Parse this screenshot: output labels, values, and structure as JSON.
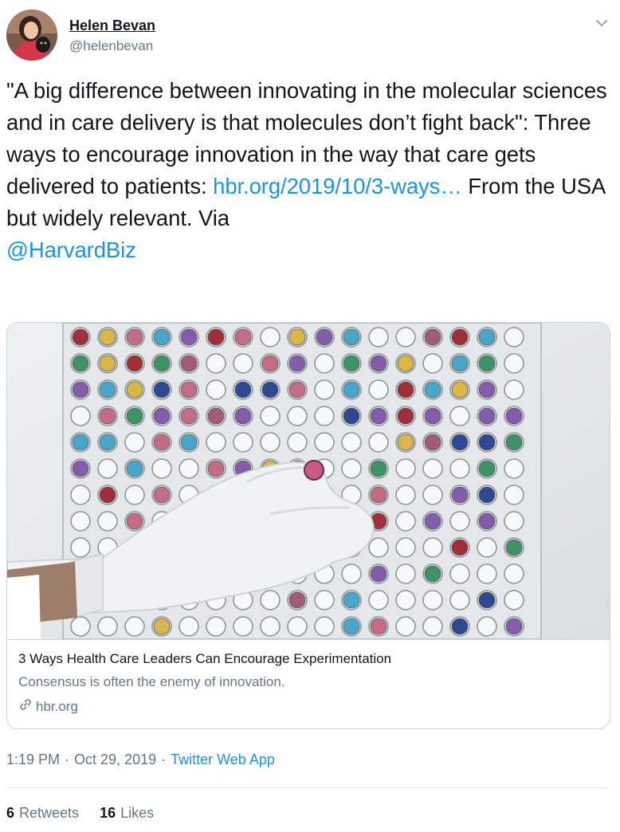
{
  "author": {
    "name": "Helen Bevan",
    "handle": "@helenbevan"
  },
  "tweet": {
    "text_1": "\"A big difference between innovating in the molecular sciences and in care delivery is that molecules don’t fight back\": Three ways to encourage innovation in the way that care gets delivered to patients: ",
    "link": "hbr.org/2019/10/3-ways…",
    "text_2": " From the USA but widely relevant. Via",
    "mention": "@HarvardBiz"
  },
  "card": {
    "title": "3 Ways Health Care Leaders Can Encourage Experimentation",
    "description": "Consensus is often the enemy of innovation.",
    "domain": "hbr.org"
  },
  "meta": {
    "time": "1:19 PM",
    "sep1": "·",
    "date": "Oct 29, 2019",
    "sep2": "·",
    "source": "Twitter Web App"
  },
  "stats": {
    "retweets_count": "6",
    "retweets_label": "Retweets",
    "likes_count": "16",
    "likes_label": "Likes"
  },
  "colors": {
    "link": "#1b95e0",
    "secondary_text": "#657786",
    "border": "#ccd6dd"
  },
  "icons": {
    "caret": "chevron-down-icon",
    "domain": "link-icon"
  }
}
